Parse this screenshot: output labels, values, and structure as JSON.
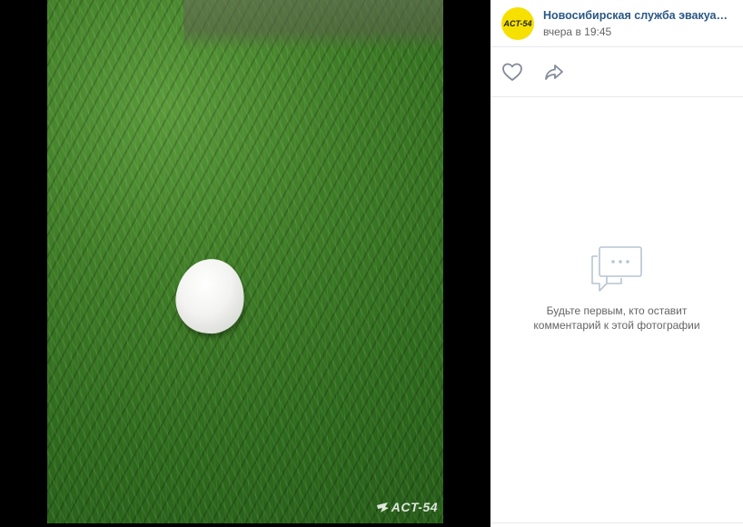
{
  "post": {
    "author": "Новосибирская служба эвакуации...",
    "date": "вчера в 19:45",
    "avatar_text": "ACT-54"
  },
  "photo": {
    "watermark": "ACT-54"
  },
  "comments": {
    "empty_text": "Будьте первым, кто оставит комментарий к этой фотографии"
  },
  "icons": {
    "like": "heart-icon",
    "share": "share-arrow-icon",
    "comments_empty": "comment-bubble-icon"
  },
  "colors": {
    "author_link": "#2a5885",
    "avatar_bg": "#f6e000",
    "icon_gray": "#828a99",
    "empty_icon": "#b8c4d3"
  }
}
